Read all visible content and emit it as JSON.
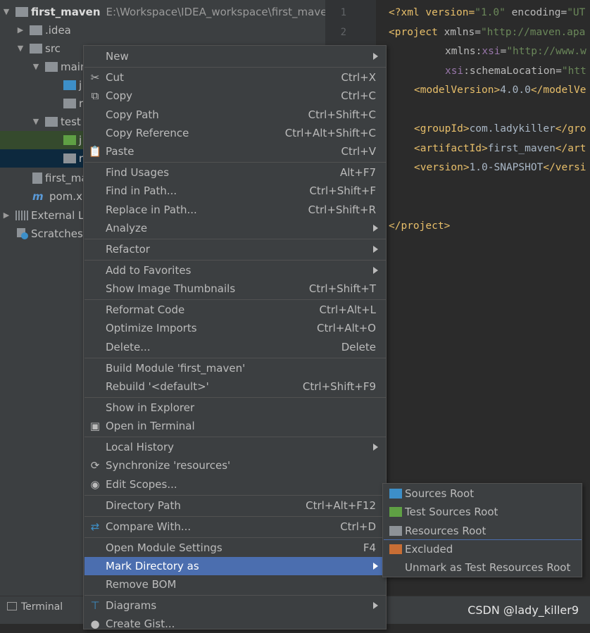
{
  "project": {
    "root_name": "first_maven",
    "root_path": "E:\\Workspace\\IDEA_workspace\\first_maven",
    "idea": ".idea",
    "src": "src",
    "main": "main",
    "main_child_1": "j",
    "main_child_2": "r",
    "test": "test",
    "test_child_1": "j",
    "test_child_2": "r",
    "iml": "first_ma",
    "pom": "pom.xr",
    "external": "External Li",
    "scratches": "Scratches"
  },
  "editor": {
    "lines": [
      "1",
      "2"
    ],
    "code": {
      "l1_a": "<?xml version=",
      "l1_b": "\"1.0\"",
      "l1_c": " encoding=",
      "l1_d": "\"UT",
      "l2_a": "<project",
      "l2_b": " xmlns=",
      "l2_c": "\"http://maven.apa",
      "l3_a": "xmlns:",
      "l3_b": "xsi",
      "l3_c": "=",
      "l3_d": "\"http://www.w",
      "l4_a": "xsi",
      "l4_b": ":schemaLocation=",
      "l4_c": "\"htt",
      "l5_a": "<modelVersion>",
      "l5_b": "4.0.0",
      "l5_c": "</modelVe",
      "l6_a": "<groupId>",
      "l6_b": "com.ladykiller",
      "l6_c": "</gro",
      "l7_a": "<artifactId>",
      "l7_b": "first_maven",
      "l7_c": "</art",
      "l8_a": "<version>",
      "l8_b": "1.0-SNAPSHOT",
      "l8_c": "</versi",
      "l9": "</project>"
    }
  },
  "menu": {
    "new": "New",
    "cut": "Cut",
    "cut_sc": "Ctrl+X",
    "copy": "Copy",
    "copy_sc": "Ctrl+C",
    "copy_path": "Copy Path",
    "copy_path_sc": "Ctrl+Shift+C",
    "copy_ref": "Copy Reference",
    "copy_ref_sc": "Ctrl+Alt+Shift+C",
    "paste": "Paste",
    "paste_sc": "Ctrl+V",
    "find_usages": "Find Usages",
    "find_usages_sc": "Alt+F7",
    "find_in_path": "Find in Path...",
    "find_in_path_sc": "Ctrl+Shift+F",
    "replace_in_path": "Replace in Path...",
    "replace_in_path_sc": "Ctrl+Shift+R",
    "analyze": "Analyze",
    "refactor": "Refactor",
    "add_fav": "Add to Favorites",
    "show_thumbs": "Show Image Thumbnails",
    "show_thumbs_sc": "Ctrl+Shift+T",
    "reformat": "Reformat Code",
    "reformat_sc": "Ctrl+Alt+L",
    "optimize": "Optimize Imports",
    "optimize_sc": "Ctrl+Alt+O",
    "delete": "Delete...",
    "delete_sc": "Delete",
    "build_module": "Build Module 'first_maven'",
    "rebuild": "Rebuild '<default>'",
    "rebuild_sc": "Ctrl+Shift+F9",
    "show_explorer": "Show in Explorer",
    "open_terminal": "Open in Terminal",
    "local_history": "Local History",
    "sync": "Synchronize 'resources'",
    "edit_scopes": "Edit Scopes...",
    "dir_path": "Directory Path",
    "dir_path_sc": "Ctrl+Alt+F12",
    "compare": "Compare With...",
    "compare_sc": "Ctrl+D",
    "module_settings": "Open Module Settings",
    "module_settings_sc": "F4",
    "mark_dir": "Mark Directory as",
    "remove_bom": "Remove BOM",
    "diagrams": "Diagrams",
    "create_gist": "Create Gist..."
  },
  "submenu": {
    "sources": "Sources Root",
    "test_sources": "Test Sources Root",
    "resources": "Resources Root",
    "excluded": "Excluded",
    "unmark": "Unmark as Test Resources Root"
  },
  "bottom": {
    "terminal": "Terminal",
    "watermark": "CSDN @lady_killer9"
  },
  "colors": {
    "menu_bg": "#3c3f41",
    "selection": "#4b6eaf",
    "editor_bg": "#2b2b2b",
    "xml_tag": "#e8bf6a",
    "xml_value": "#6a8759"
  }
}
